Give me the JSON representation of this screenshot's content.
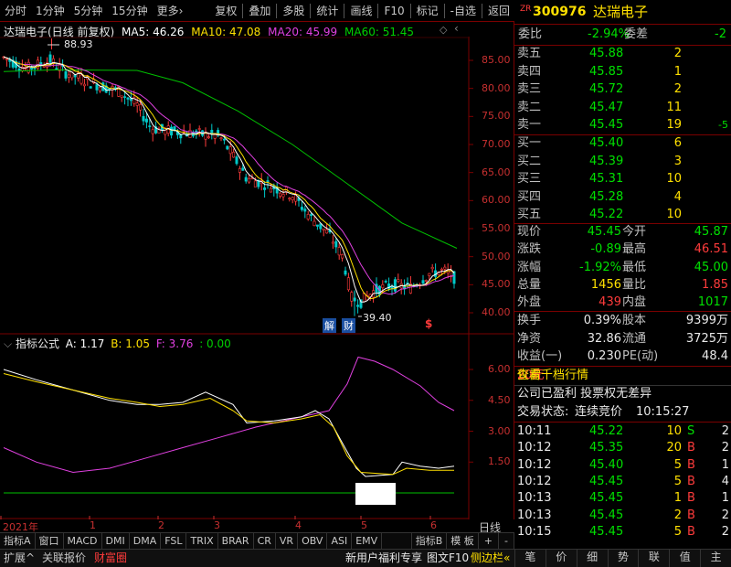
{
  "toolbar": {
    "left": [
      "分时",
      "1分钟",
      "5分钟",
      "15分钟",
      "更多›"
    ],
    "right": [
      "复权",
      "叠加",
      "多股",
      "统计",
      "画线",
      "F10",
      "标记",
      "-自选",
      "返回"
    ]
  },
  "chart": {
    "title": "达瑞电子(日线 前复权)",
    "ma": [
      {
        "label": "MA5: 46.26",
        "color": "#ffffff"
      },
      {
        "label": "MA10: 47.08",
        "color": "#ffe000"
      },
      {
        "label": "MA20: 45.99",
        "color": "#e040e0"
      },
      {
        "label": "MA60: 51.45",
        "color": "#00d000"
      }
    ],
    "price_ticks": [
      "85.00",
      "80.00",
      "75.00",
      "70.00",
      "65.00",
      "60.00",
      "55.00",
      "50.00",
      "45.00",
      "40.00"
    ],
    "high_label": "88.93",
    "low_label": "39.40",
    "markers": [
      "解",
      "财",
      "$"
    ],
    "indicator": {
      "name": "指标公式",
      "values": [
        {
          "label": "A: 1.17",
          "color": "#ffffff"
        },
        {
          "label": "B: 1.05",
          "color": "#ffe000"
        },
        {
          "label": "F: 3.76",
          "color": "#e040e0"
        },
        {
          "label": ": 0.00",
          "color": "#00d000"
        }
      ],
      "ticks": [
        "6.00",
        "4.50",
        "3.00",
        "1.50"
      ]
    },
    "date_labels": [
      "2021年",
      "1",
      "2",
      "3",
      "4",
      "5",
      "6"
    ],
    "axis_corner": "日线"
  },
  "tabs_row1": [
    "指标A",
    "窗口",
    "MACD",
    "DMI",
    "DMA",
    "FSL",
    "TRIX",
    "BRAR",
    "CR",
    "VR",
    "OBV",
    "ASI",
    "EMV",
    "指标B",
    "模 板",
    "+",
    "-"
  ],
  "tabs_row2": {
    "left": [
      "扩展^",
      "关联报价",
      "财富圈"
    ],
    "right": [
      "新用户福利专享",
      "图文F10",
      "侧边栏«"
    ]
  },
  "stock": {
    "prefix": "ZR",
    "code": "300976",
    "name": "达瑞电子",
    "weibi_label": "委比",
    "weibi": "-2.94%",
    "weicha_label": "委差",
    "weicha": "-2",
    "sell": [
      {
        "label": "卖五",
        "price": "45.88",
        "vol": "2",
        "chg": ""
      },
      {
        "label": "卖四",
        "price": "45.85",
        "vol": "1",
        "chg": ""
      },
      {
        "label": "卖三",
        "price": "45.72",
        "vol": "2",
        "chg": ""
      },
      {
        "label": "卖二",
        "price": "45.47",
        "vol": "11",
        "chg": ""
      },
      {
        "label": "卖一",
        "price": "45.45",
        "vol": "19",
        "chg": "-5"
      }
    ],
    "buy": [
      {
        "label": "买一",
        "price": "45.40",
        "vol": "6"
      },
      {
        "label": "买二",
        "price": "45.39",
        "vol": "3"
      },
      {
        "label": "买三",
        "price": "45.31",
        "vol": "10"
      },
      {
        "label": "买四",
        "price": "45.28",
        "vol": "4"
      },
      {
        "label": "买五",
        "price": "45.22",
        "vol": "10"
      }
    ],
    "quote": [
      {
        "l1": "现价",
        "v1": "45.45",
        "c1": "green",
        "l2": "今开",
        "v2": "45.87",
        "c2": "green"
      },
      {
        "l1": "涨跌",
        "v1": "-0.89",
        "c1": "green",
        "l2": "最高",
        "v2": "46.51",
        "c2": "red"
      },
      {
        "l1": "涨幅",
        "v1": "-1.92%",
        "c1": "green",
        "l2": "最低",
        "v2": "45.00",
        "c2": "green"
      },
      {
        "l1": "总量",
        "v1": "1456",
        "c1": "yellow",
        "l2": "量比",
        "v2": "1.85",
        "c2": "red"
      },
      {
        "l1": "外盘",
        "v1": "439",
        "c1": "red",
        "l2": "内盘",
        "v2": "1017",
        "c2": "green"
      }
    ],
    "stats": [
      {
        "l1": "换手",
        "v1": "0.39%",
        "l2": "股本",
        "v2": "9399万"
      },
      {
        "l1": "净资",
        "v1": "32.86",
        "l2": "流通",
        "v2": "3725万"
      },
      {
        "l1": "收益(一)",
        "v1": "0.230",
        "l2": "PE(动)",
        "v2": "48.4"
      }
    ],
    "promo1_a": "仅需",
    "promo1_b": "20元",
    "promo1_c": "查看千档行情",
    "promo2": "公司已盈利 投票权无差异",
    "status_label": "交易状态:",
    "status": "连续竞价",
    "status_time": "10:15:27",
    "ticks": [
      {
        "time": "10:11",
        "price": "45.22",
        "vol": "10",
        "bs": "S",
        "n": "2"
      },
      {
        "time": "10:12",
        "price": "45.35",
        "vol": "20",
        "bs": "B",
        "n": "2"
      },
      {
        "time": "10:12",
        "price": "45.40",
        "vol": "5",
        "bs": "B",
        "n": "1"
      },
      {
        "time": "10:12",
        "price": "45.45",
        "vol": "5",
        "bs": "B",
        "n": "4"
      },
      {
        "time": "10:13",
        "price": "45.45",
        "vol": "1",
        "bs": "B",
        "n": "1"
      },
      {
        "time": "10:13",
        "price": "45.45",
        "vol": "2",
        "bs": "B",
        "n": "2"
      },
      {
        "time": "10:15",
        "price": "45.45",
        "vol": "5",
        "bs": "B",
        "n": "2"
      }
    ]
  },
  "right_tabs": [
    "笔",
    "价",
    "细",
    "势",
    "联",
    "值",
    "主"
  ],
  "colors": {
    "up": "#ff3b3b",
    "down": "#00e000",
    "frame": "#7a0000",
    "vol": "#ffe000"
  }
}
